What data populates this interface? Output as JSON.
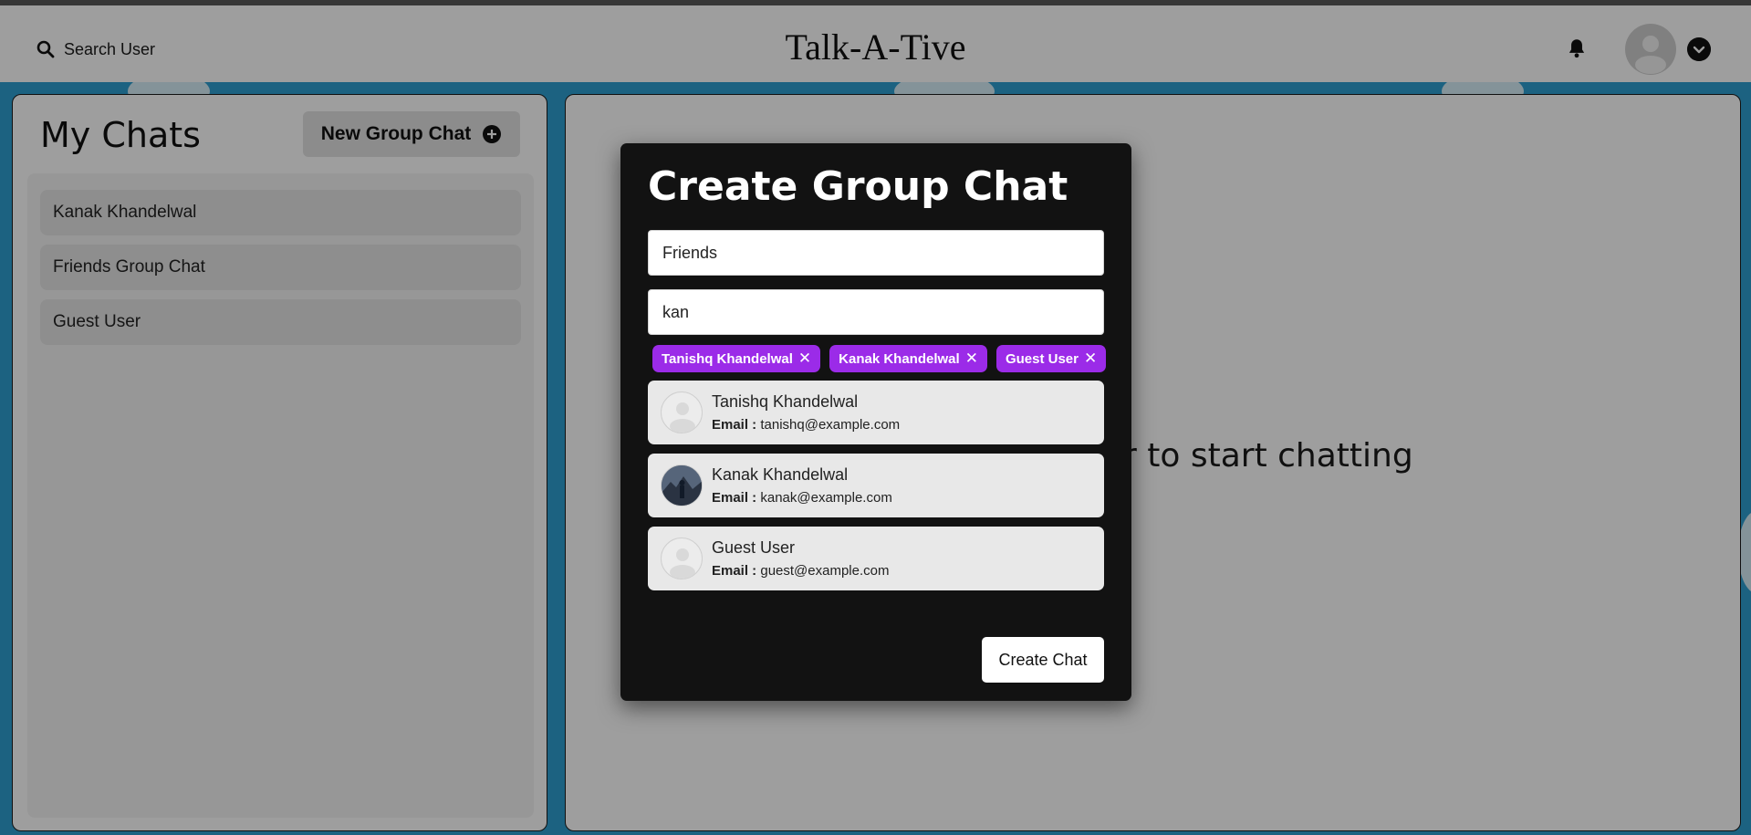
{
  "header": {
    "search_label": "Search User",
    "app_title": "Talk-A-Tive",
    "icons": [
      "search-icon",
      "bell-icon",
      "avatar",
      "chevron-down-icon"
    ]
  },
  "sidebar": {
    "title": "My Chats",
    "new_group_label": "New Group Chat",
    "chats": [
      {
        "name": "Kanak Khandelwal"
      },
      {
        "name": "Friends Group Chat"
      },
      {
        "name": "Guest User"
      }
    ]
  },
  "main": {
    "placeholder": "Click on a user to start chatting"
  },
  "modal": {
    "title": "Create Group Chat",
    "chat_name_value": "Friends",
    "search_value": "kan",
    "selected_users": [
      {
        "name": "Tanishq Khandelwal"
      },
      {
        "name": "Kanak Khandelwal"
      },
      {
        "name": "Guest User"
      }
    ],
    "results": [
      {
        "name": "Tanishq Khandelwal",
        "email_label": "Email :",
        "email": "tanishq@example.com",
        "avatar": "default"
      },
      {
        "name": "Kanak Khandelwal",
        "email_label": "Email :",
        "email": "kanak@example.com",
        "avatar": "photo"
      },
      {
        "name": "Guest User",
        "email_label": "Email :",
        "email": "guest@example.com",
        "avatar": "default"
      }
    ],
    "create_label": "Create Chat"
  },
  "colors": {
    "background": "#2e9fd0",
    "chip": "#9b2be8",
    "modal": "#121212"
  }
}
